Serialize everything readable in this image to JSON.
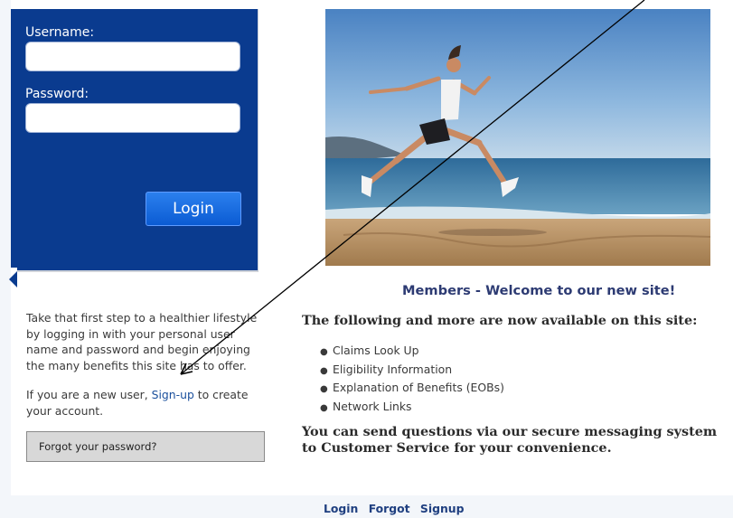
{
  "login": {
    "username_label": "Username:",
    "username_value": "",
    "password_label": "Password:",
    "password_value": "",
    "login_button": "Login"
  },
  "intro": {
    "text": "Take that first step to a healthier lifestyle by logging in with your personal user name and password and begin enjoying the many benefits this site has to offer.",
    "newuser_prefix": "If you are a new user, ",
    "signup_link": "Sign-up",
    "newuser_suffix": " to create your account."
  },
  "forgot_button": "Forgot your password?",
  "main": {
    "heading": "Members - Welcome to our new site!",
    "subheading": "The following and more are now available on this site:",
    "features": [
      "Claims Look Up",
      "Eligibility Information",
      "Explanation of Benefits (EOBs)",
      "Network Links"
    ],
    "closing": "You can send questions via our secure messaging system to Customer Service for your convenience."
  },
  "footer": {
    "login": "Login",
    "forgot": "Forgot",
    "signup": "Signup"
  },
  "colors": {
    "panel": "#0a3b8f",
    "button": "#0b5bd3",
    "heading": "#2d3b73",
    "link": "#1a4f9c"
  }
}
